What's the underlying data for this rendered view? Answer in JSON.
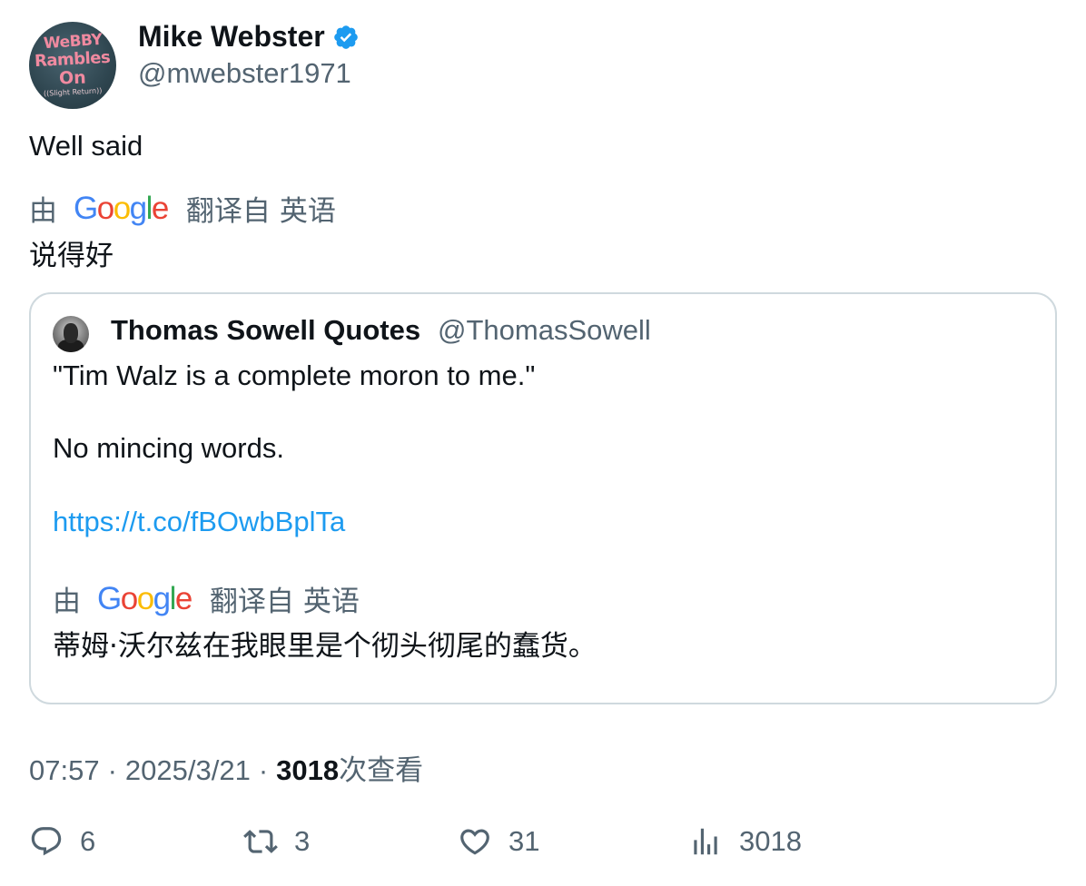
{
  "author": {
    "avatar_text": [
      "WeBBY",
      "Rambles",
      "On",
      "((Slight Return))"
    ],
    "name": "Mike Webster",
    "handle": "@mwebster1971"
  },
  "tweet": {
    "text": "Well said",
    "translation": {
      "by": "由",
      "provider": "Google",
      "translated_from": "翻译自",
      "language": "英语",
      "text": "说得好"
    }
  },
  "quote": {
    "name": "Thomas Sowell Quotes",
    "handle": "@ThomasSowell",
    "line1": "\"Tim Walz is a complete moron to me.\"",
    "line2": "No mincing words.",
    "link": "https://t.co/fBOwbBplTa",
    "translation": {
      "by": "由",
      "provider": "Google",
      "translated_from": "翻译自",
      "language": "英语",
      "text": "蒂姆·沃尔兹在我眼里是个彻头彻尾的蠢货。"
    }
  },
  "meta": {
    "time": "07:57",
    "sep1": "·",
    "date": "2025/3/21",
    "sep2": "·",
    "views_count": "3018",
    "views_label": "次查看"
  },
  "actions": {
    "replies": "6",
    "reposts": "3",
    "likes": "31",
    "views": "3018"
  },
  "colors": {
    "text": "#0f1419",
    "secondary": "#536471",
    "link": "#1d9bf0",
    "border": "#cfd9de",
    "verified": "#1d9bf0"
  }
}
